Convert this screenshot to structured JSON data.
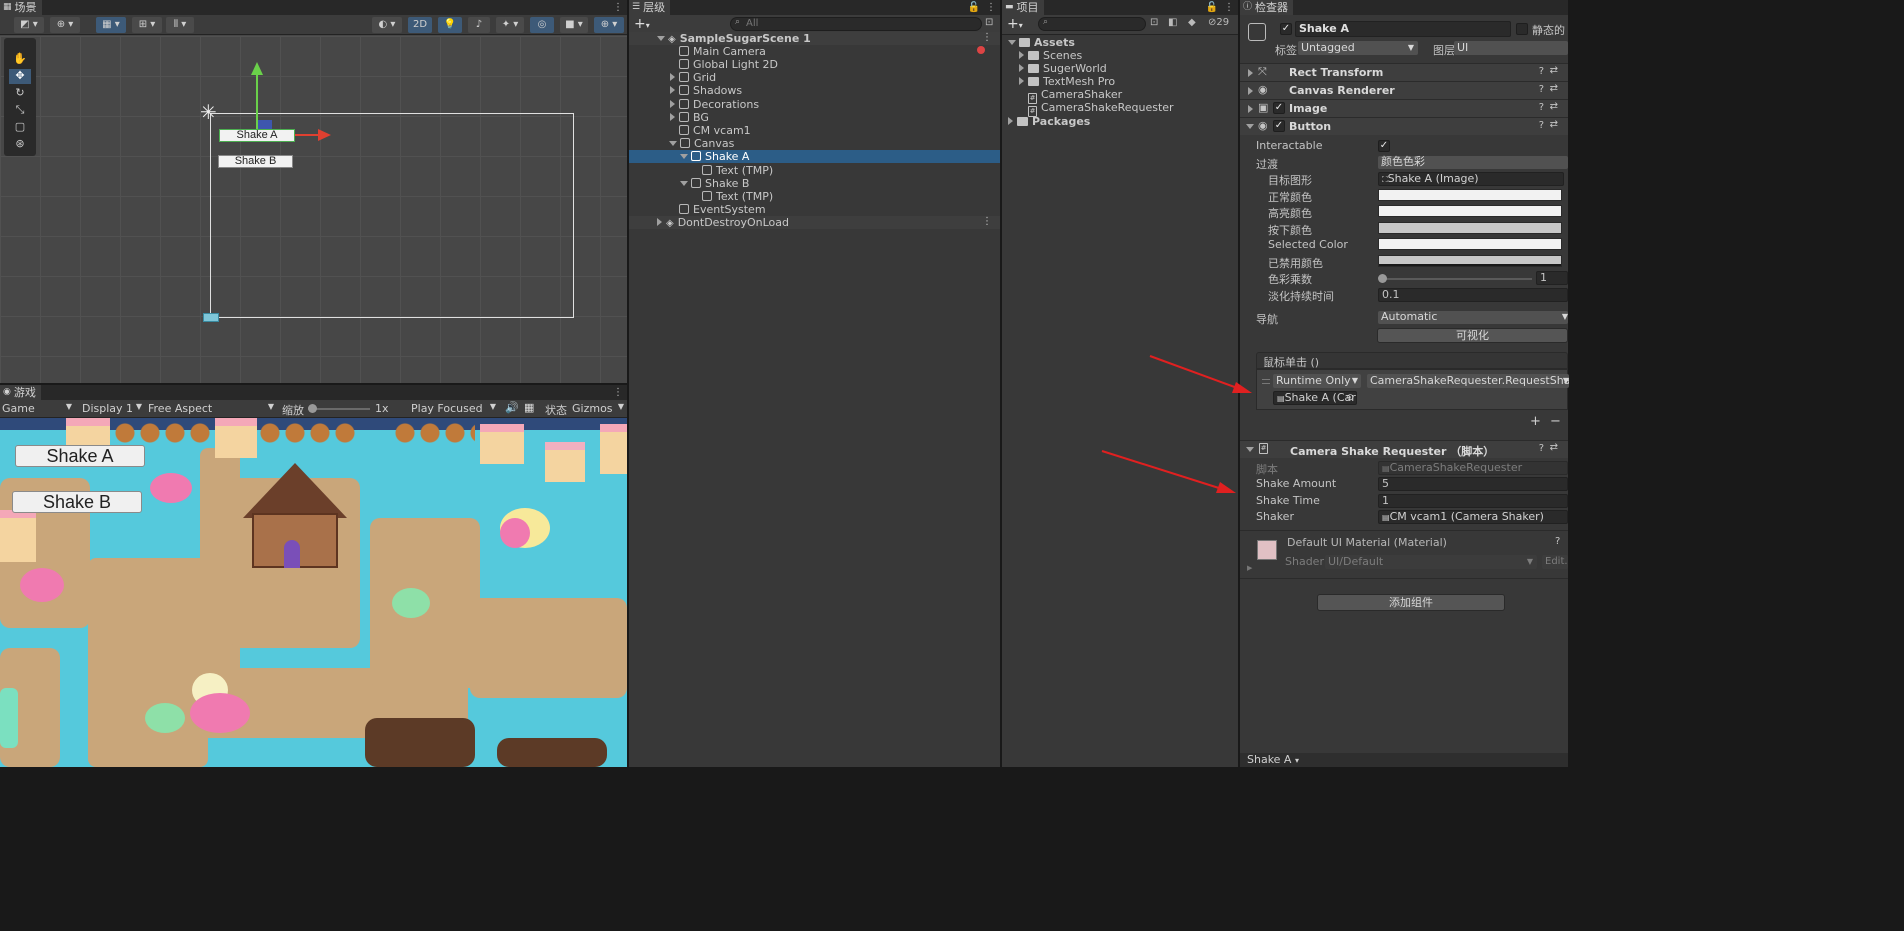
{
  "scene": {
    "tab": "场景",
    "btn_2d": "2D",
    "shake_a": "Shake A",
    "shake_b": "Shake B"
  },
  "game": {
    "tab": "游戏",
    "mode": "Game",
    "display": "Display 1",
    "aspect": "Free Aspect",
    "scale_label": "缩放",
    "scale_value": "1x",
    "play_focused": "Play Focused",
    "stats": "状态",
    "gizmos": "Gizmos",
    "shake_a": "Shake A",
    "shake_b": "Shake B"
  },
  "hierarchy": {
    "tab": "层级",
    "search_placeholder": "All",
    "scene_name": "SampleSugarScene 1",
    "items": [
      "Main Camera",
      "Global Light 2D",
      "Grid",
      "Shadows",
      "Decorations",
      "BG",
      "CM vcam1",
      "Canvas",
      "Shake A",
      "Text (TMP)",
      "Shake B",
      "Text (TMP)",
      "EventSystem"
    ],
    "dont_destroy": "DontDestroyOnLoad"
  },
  "project": {
    "tab": "项目",
    "count": "29",
    "assets": "Assets",
    "children": [
      "Scenes",
      "SugerWorld",
      "TextMesh Pro",
      "CameraShaker",
      "CameraShakeRequester"
    ],
    "packages": "Packages"
  },
  "inspector": {
    "tab": "检查器",
    "object_name": "Shake A",
    "static_label": "静态的",
    "tag_label": "标签",
    "tag_value": "Untagged",
    "layer_label": "图层",
    "layer_value": "UI",
    "components": {
      "rect_transform": "Rect Transform",
      "canvas_renderer": "Canvas Renderer",
      "image": "Image",
      "button": "Button",
      "camera_shake_requester": "Camera Shake Requester （脚本）"
    },
    "button": {
      "interactable_label": "Interactable",
      "transition_label": "过渡",
      "transition_value": "颜色色彩",
      "target_graphic_label": "目标图形",
      "target_graphic_value": "Shake A (Image)",
      "normal_label": "正常颜色",
      "highlighted_label": "高亮颜色",
      "pressed_label": "按下颜色",
      "selected_label": "Selected Color",
      "disabled_label": "已禁用颜色",
      "multiplier_label": "色彩乘数",
      "multiplier_value": "1",
      "fade_label": "淡化持续时间",
      "fade_value": "0.1",
      "nav_label": "导航",
      "nav_value": "Automatic",
      "visualize": "可视化",
      "onclick_label": "鼠标单击 ()",
      "runtime_value": "Runtime Only",
      "function_value": "CameraShakeRequester.RequestShake",
      "target_obj": "Shake A (Car",
      "plus": "+",
      "minus": "−"
    },
    "requester": {
      "script_label": "脚本",
      "script_value": "CameraShakeRequester",
      "amount_label": "Shake Amount",
      "amount_value": "5",
      "time_label": "Shake Time",
      "time_value": "1",
      "shaker_label": "Shaker",
      "shaker_value": "CM vcam1 (Camera Shaker)"
    },
    "material": {
      "name": "Default UI Material (Material)",
      "shader_label": "Shader",
      "shader_value": "UI/Default",
      "edit": "Edit..."
    },
    "add_component": "添加组件",
    "footer": "Shake A"
  },
  "colors": {
    "accent_arrow": "#e02020",
    "selection": "#2c5d87"
  }
}
